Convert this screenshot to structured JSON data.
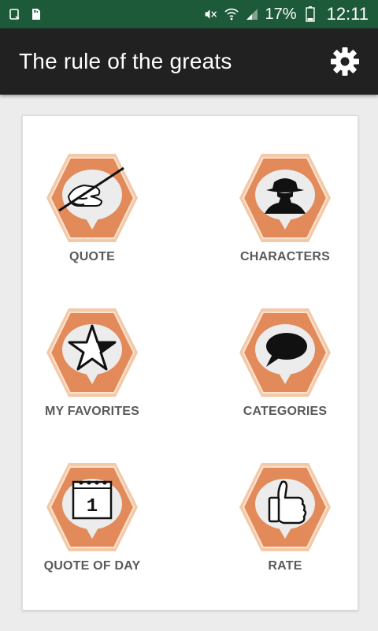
{
  "status_bar": {
    "battery_percent": "17%",
    "time": "12:11",
    "icons": [
      "screenshot-icon",
      "sd-card-icon",
      "mute-icon",
      "wifi-icon",
      "signal-icon",
      "battery-icon"
    ]
  },
  "app_bar": {
    "title": "The rule of the greats",
    "settings_icon": "gear-icon"
  },
  "colors": {
    "status_bar_bg": "#1c5a3a",
    "app_bar_bg": "#212121",
    "badge_fill": "#e28a5a",
    "label_color": "#5a5a5a"
  },
  "menu": {
    "items": [
      {
        "label": "QUOTE",
        "icon": "hand-writing-icon"
      },
      {
        "label": "CHARACTERS",
        "icon": "detective-icon"
      },
      {
        "label": "MY FAVORITES",
        "icon": "star-icon"
      },
      {
        "label": "CATEGORIES",
        "icon": "speech-bubble-icon"
      },
      {
        "label": "QUOTE OF DAY",
        "icon": "calendar-icon"
      },
      {
        "label": "RATE",
        "icon": "thumbs-up-icon"
      }
    ],
    "calendar_day": "1"
  }
}
